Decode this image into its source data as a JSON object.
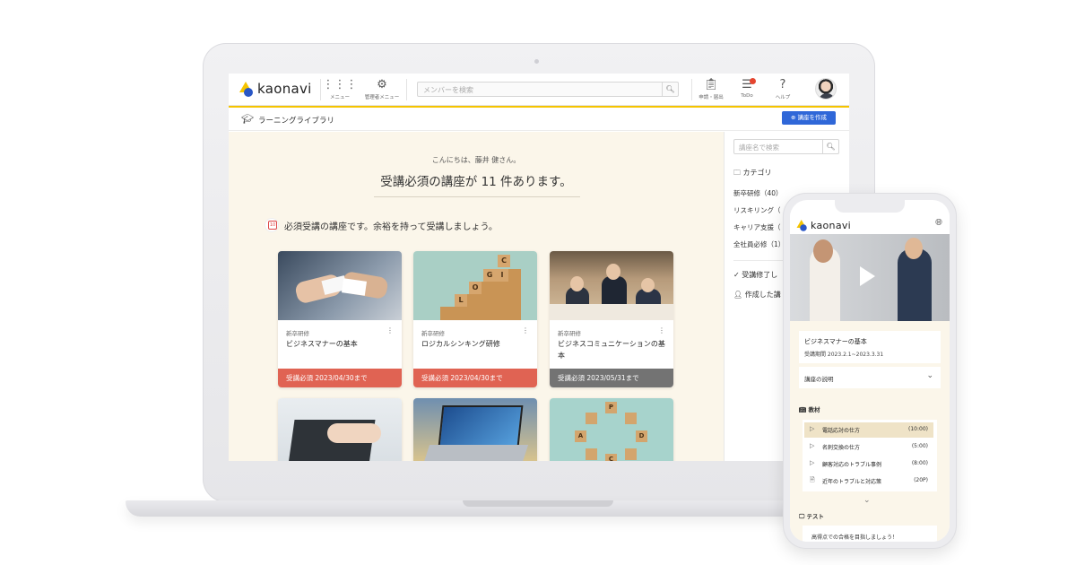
{
  "laptop": {
    "brand": "kaonavi",
    "topbar": {
      "menu_label": "メニュー",
      "admin_menu_label": "管理者メニュー",
      "search_placeholder": "メンバーを検索",
      "apply_label": "申請・届出",
      "todo_label": "ToDo",
      "help_label": "ヘルプ"
    },
    "subbar": {
      "title": "ラーニングライブラリ",
      "create_button": "講座を作成"
    },
    "main": {
      "greeting": "こんにちは、藤井 健さん。",
      "headline": "受講必須の講座が 11 件あります。",
      "notice": "必須受講の講座です。余裕を持って受講しましょう。",
      "cards": [
        {
          "category": "新卒研修",
          "title": "ビジネスマナーの基本",
          "due": "受講必須 2023/04/30まで",
          "due_color": "#e06353"
        },
        {
          "category": "新卒研修",
          "title": "ロジカルシンキング研修",
          "due": "受講必須 2023/04/30まで",
          "due_color": "#e06353"
        },
        {
          "category": "新卒研修",
          "title": "ビジネスコミュニケーションの基本",
          "due": "受講必須 2023/05/31まで",
          "due_color": "#737373"
        }
      ]
    },
    "side": {
      "search_placeholder": "講座名で検索",
      "category_heading": "カテゴリ",
      "categories": [
        "新卒研修（40）",
        "リスキリング（",
        "キャリア支援（",
        "全社員必修（1）"
      ],
      "completed_label": "受講修了し",
      "created_label": "作成した講"
    }
  },
  "phone": {
    "brand": "kaonavi",
    "course_title": "ビジネスマナーの基本",
    "course_period": "受講期間 2023.2.1~2023.3.31",
    "description_label": "講座の説明",
    "materials_heading": "教材",
    "materials": [
      {
        "name": "電話応対の仕方",
        "time": "(10:00)",
        "icon": "play-icon"
      },
      {
        "name": "名刺交換の仕方",
        "time": "(5:00)",
        "icon": "play-icon"
      },
      {
        "name": "顧客対応のトラブル事例",
        "time": "(8:00)",
        "icon": "play-icon"
      },
      {
        "name": "近年のトラブルと対応策",
        "time": "(20P)",
        "icon": "document-icon"
      }
    ],
    "test_heading": "テスト",
    "test_text": "高得点での合格を目指しましょう！"
  },
  "colors": {
    "accent_yellow": "#f5c400",
    "brand_blue": "#2a57c6",
    "button_blue": "#2f67d8",
    "required_red": "#e06353",
    "required_gray": "#737373",
    "main_bg": "#fbf6ea"
  }
}
